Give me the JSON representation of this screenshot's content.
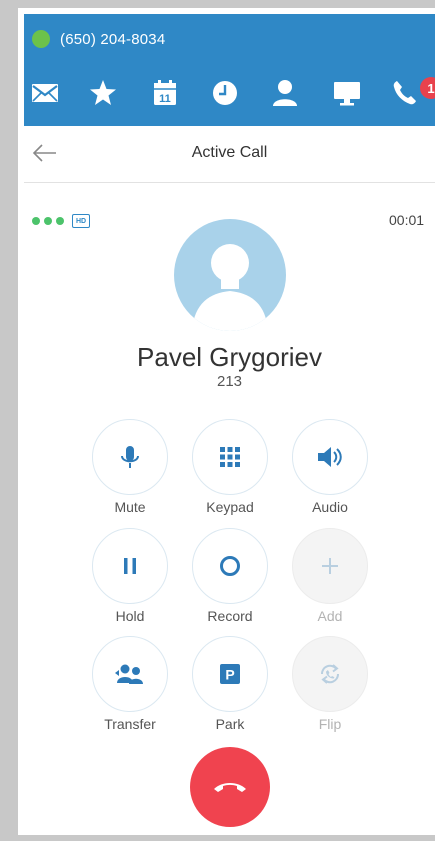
{
  "status": {
    "phone_number": "(650) 204-8034"
  },
  "toolbar": {
    "icons": [
      "envelope-icon",
      "star-icon",
      "calendar-icon",
      "clock-icon",
      "contacts-icon",
      "monitor-icon",
      "phone-icon"
    ],
    "calendar_day": "11",
    "badge_count": "1"
  },
  "header": {
    "title": "Active Call"
  },
  "call": {
    "timer": "00:01",
    "name": "Pavel Grygoriev",
    "extension": "213",
    "hd": "HD"
  },
  "controls": {
    "mute": "Mute",
    "keypad": "Keypad",
    "audio": "Audio",
    "hold": "Hold",
    "record": "Record",
    "add": "Add",
    "transfer": "Transfer",
    "park": "Park",
    "flip": "Flip",
    "park_glyph": "P"
  },
  "colors": {
    "brand": "#2f88c6",
    "accent_icon": "#2d7ab8",
    "hangup": "#f0434f",
    "online": "#6cc24a"
  }
}
